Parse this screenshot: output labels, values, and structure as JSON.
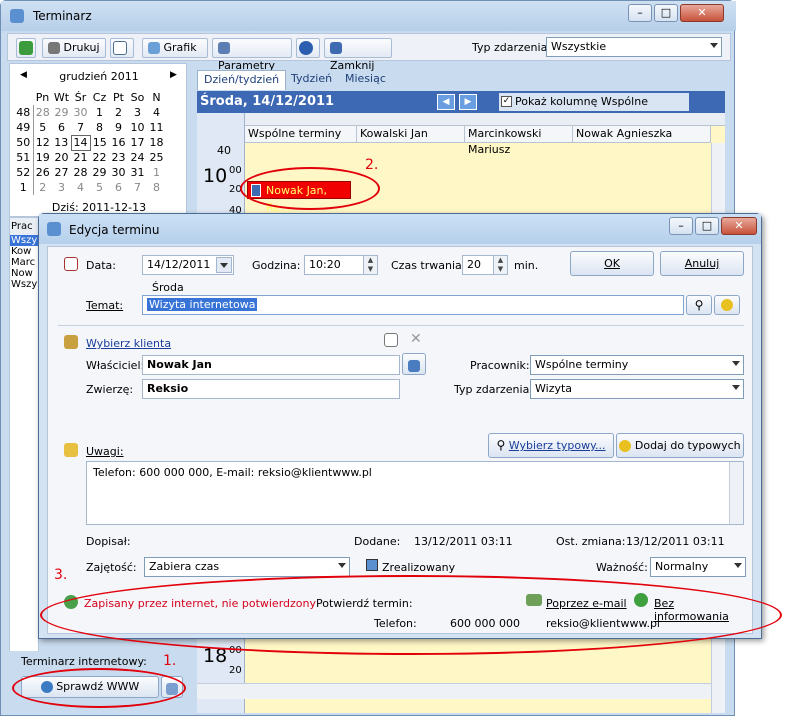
{
  "main": {
    "title": "Terminarz",
    "toolbar": {
      "drukuj": "Drukuj",
      "grafik": "Grafik",
      "parametry": "Parametry",
      "zamknij": "Zamknij",
      "typ_label": "Typ zdarzenia:",
      "typ_value": "Wszystkie"
    },
    "calendar": {
      "month": "grudzień 2011",
      "weekdays": [
        "Pn",
        "Wt",
        "Śr",
        "Cz",
        "Pt",
        "So",
        "N"
      ],
      "rows": [
        [
          "48",
          "28",
          "29",
          "30",
          "1",
          "2",
          "3",
          "4"
        ],
        [
          "49",
          "5",
          "6",
          "7",
          "8",
          "9",
          "10",
          "11"
        ],
        [
          "50",
          "12",
          "13",
          "14",
          "15",
          "16",
          "17",
          "18"
        ],
        [
          "51",
          "19",
          "20",
          "21",
          "22",
          "23",
          "24",
          "25"
        ],
        [
          "52",
          "26",
          "27",
          "28",
          "29",
          "30",
          "31",
          "1"
        ],
        [
          "1",
          "2",
          "3",
          "4",
          "5",
          "6",
          "7",
          "8"
        ]
      ],
      "today": "Dziś: 2011-12-13"
    },
    "left_list": {
      "header": "Prac",
      "items": [
        "Wszy",
        "Kow",
        "Marc",
        "Now",
        "Wszy"
      ]
    },
    "internet_label": "Terminarz internetowy:",
    "check_www": "Sprawdź WWW",
    "tabs": [
      "Dzień/tydzień",
      "Tydzień",
      "Miesiąc"
    ],
    "day_title": "Środa,  14/12/2011",
    "show_common": "Pokaż kolumnę Wspólne terminy",
    "columns": [
      "Wspólne terminy",
      "Kowalski Jan",
      "Marcinkowski Mariusz",
      "Nowak Agnieszka"
    ],
    "hour_labels": {
      "m40a": "40",
      "h10": "10",
      "m00": "00",
      "m20": "20",
      "m40b": "40",
      "h18": "18",
      "m00b": "00",
      "m20b": "20"
    },
    "event": "Nowak Jan, Re...",
    "annot": {
      "n1": "1.",
      "n2": "2.",
      "n3": "3."
    }
  },
  "dialog": {
    "title": "Edycja terminu",
    "data_label": "Data:",
    "data_value": "14/12/2011",
    "day_name": "Środa",
    "godzina_label": "Godzina:",
    "godzina_value": "10:20",
    "czas_label": "Czas trwania:",
    "czas_value": "20",
    "min": "min.",
    "ok": "OK",
    "anuluj": "Anuluj",
    "temat_label": "Temat:",
    "temat_value": "Wizyta internetowa",
    "wybierz_klienta": "Wybierz klienta",
    "wlasciciel_label": "Właściciel:",
    "wlasciciel_value": "Nowak Jan",
    "zwierze_label": "Zwierzę:",
    "zwierze_value": "Reksio",
    "pracownik_label": "Pracownik:",
    "pracownik_value": "Wspólne terminy",
    "typ_label": "Typ zdarzenia:",
    "typ_value": "Wizyta",
    "uwagi_label": "Uwagi:",
    "wybierz_typowy": "Wybierz typowy...",
    "dodaj_typowych": "Dodaj do typowych",
    "uwagi_value": "Telefon: 600 000 000, E-mail: reksio@klientwww.pl",
    "dopisal_label": "Dopisał:",
    "dodane_label": "Dodane:",
    "dodane_value": "13/12/2011 03:11",
    "ost_label": "Ost. zmiana:",
    "ost_value": "13/12/2011 03:11",
    "zajetosc_label": "Zajętość:",
    "zajetosc_value": "Zabiera czas",
    "zrealizowany": "Zrealizowany",
    "waznosc_label": "Ważność:",
    "waznosc_value": "Normalny",
    "status": "Zapisany przez internet, nie potwierdzony",
    "potwierdz": "Potwierdź termin:",
    "email_btn": "Poprzez e-mail",
    "bez_btn": "Bez informowania",
    "telefon_label": "Telefon:",
    "telefon_value": "600 000 000",
    "email_value": "reksio@klientwww.pl"
  }
}
